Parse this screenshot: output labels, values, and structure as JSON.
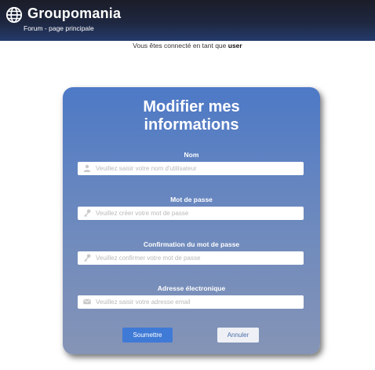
{
  "header": {
    "brand": "Groupomania",
    "nav_link": "Forum - page principale",
    "logo_icon": "globe-icon"
  },
  "status": {
    "prefix": "Vous êtes connecté en tant que",
    "username": "user"
  },
  "form": {
    "title_line1": "Modifier mes",
    "title_line2": "informations",
    "fields": [
      {
        "label": "Nom",
        "placeholder": "Veuillez saisir votre nom d'utilisateur",
        "value": "",
        "icon": "user-icon"
      },
      {
        "label": "Mot de passe",
        "placeholder": "Veuillez créer votre mot de passe",
        "value": "",
        "icon": "key-icon"
      },
      {
        "label": "Confirmation du mot de passe",
        "placeholder": "Veuillez confirmer votre mot de passe",
        "value": "",
        "icon": "key-icon"
      },
      {
        "label": "Adresse électronique",
        "placeholder": "Veuillez saisir votre adresse email",
        "value": "",
        "icon": "email-icon"
      }
    ],
    "submit_label": "Soumettre",
    "cancel_label": "Annuler"
  },
  "colors": {
    "header_top": "#1b1d28",
    "header_bottom": "#243a6b",
    "card_top": "#4d79c6",
    "card_bottom": "#8594b6",
    "submit_button": "#3f7ad6",
    "cancel_button": "#eef0f5"
  }
}
